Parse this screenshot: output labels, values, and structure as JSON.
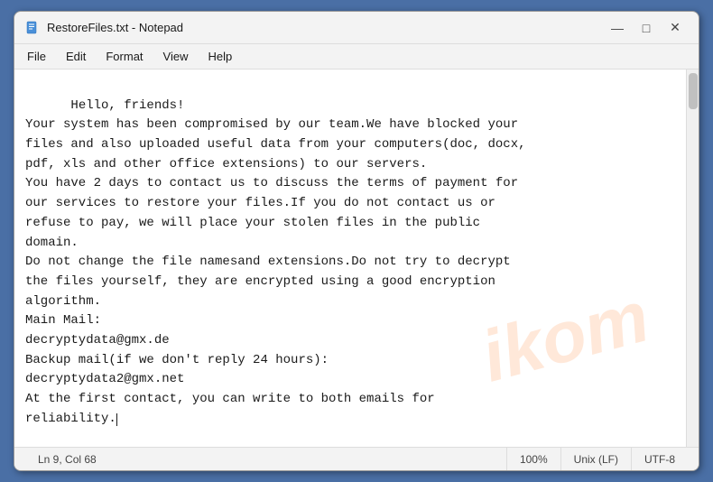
{
  "window": {
    "title": "RestoreFiles.txt - Notepad",
    "icon": "📄"
  },
  "titlebar": {
    "minimize_label": "—",
    "maximize_label": "□",
    "close_label": "✕"
  },
  "menubar": {
    "items": [
      "File",
      "Edit",
      "Format",
      "View",
      "Help"
    ]
  },
  "editor": {
    "content": "Hello, friends!\nYour system has been compromised by our team.We have blocked your\nfiles and also uploaded useful data from your computers(doc, docx,\npdf, xls and other office extensions) to our servers.\nYou have 2 days to contact us to discuss the terms of payment for\nour services to restore your files.If you do not contact us or\nrefuse to pay, we will place your stolen files in the public\ndomain.\nDo not change the file namesand extensions.Do not try to decrypt\nthe files yourself, they are encrypted using a good encryption\nalgorithm.\nMain Mail:\ndecryptydata@gmx.de\nBackup mail(if we don't reply 24 hours):\ndecryptydata2@gmx.net\nAt the first contact, you can write to both emails for\nreliability.",
    "watermark": "ikom"
  },
  "statusbar": {
    "ln_col": "Ln 9, Col 68",
    "zoom": "100%",
    "line_ending": "Unix (LF)",
    "encoding": "UTF-8"
  }
}
